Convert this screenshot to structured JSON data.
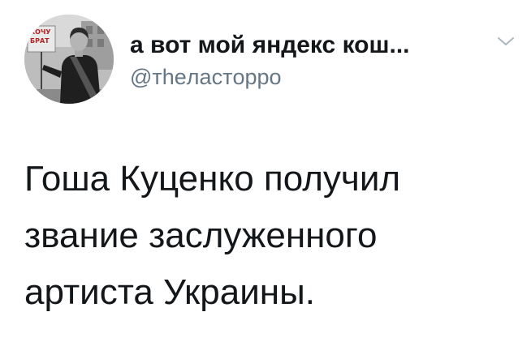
{
  "tweet": {
    "display_name": "а вот мой яндекс кош...",
    "handle": "@тheластoppo",
    "avatar": {
      "description_icon": "profile-photo-icon",
      "sign_text": [
        "ХОЧУ",
        "БРАТ"
      ]
    },
    "menu_icon": "chevron-down-icon",
    "text_lines": [
      "Гоша Куценко получил",
      "звание заслуженного",
      "артиста Украины."
    ]
  },
  "colors": {
    "primary_text": "#14171a",
    "secondary_text": "#657786",
    "chevron": "#aab8c2",
    "background": "#ffffff"
  }
}
